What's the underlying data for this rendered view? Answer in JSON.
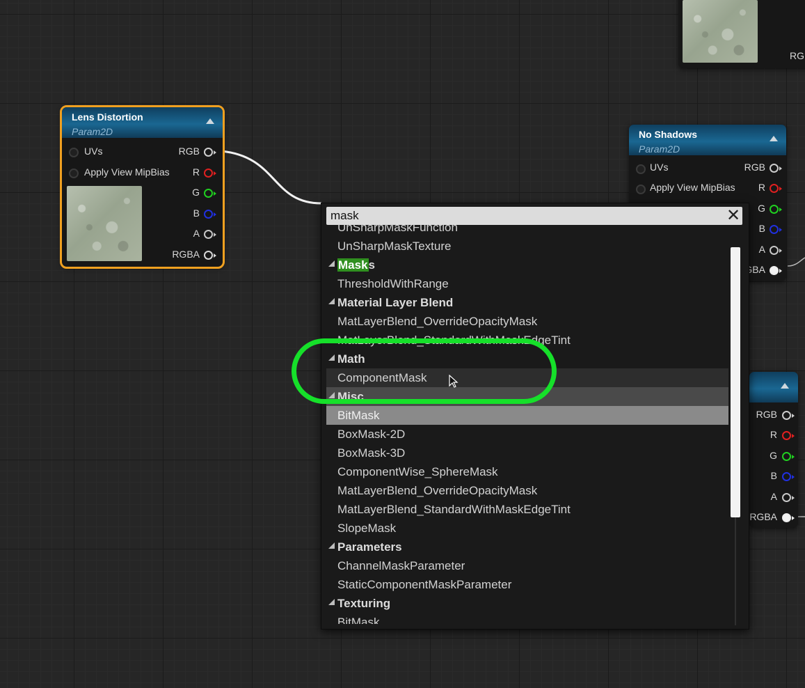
{
  "nodes": {
    "lens": {
      "title": "Lens Distortion",
      "subtitle": "Param2D",
      "inputs": [
        "UVs",
        "Apply View MipBias"
      ],
      "outputs": [
        "RGB",
        "R",
        "G",
        "B",
        "A",
        "RGBA"
      ]
    },
    "noshadows": {
      "title": "No Shadows",
      "subtitle": "Param2D",
      "inputs": [
        "UVs",
        "Apply View MipBias"
      ],
      "outputs": [
        "RGB",
        "R",
        "G",
        "B",
        "A",
        "GBA"
      ]
    },
    "topright": {
      "output_partial": "RGE"
    },
    "right3": {
      "outputs": [
        "RGB",
        "R",
        "G",
        "B",
        "A",
        "RGBA"
      ]
    }
  },
  "colors": {
    "R": "#e02020",
    "G": "#20d020",
    "B": "#2030e0",
    "A": "#c8c8c8",
    "selected_border": "#f0a020",
    "annotation": "#16e02a",
    "match_highlight": "#2f8f1f"
  },
  "search": {
    "value": "mask",
    "clear_icon": "close-icon",
    "items": [
      {
        "text": "UnSharpMaskFunction",
        "kind": "item"
      },
      {
        "text": "UnSharpMaskTexture",
        "kind": "item"
      },
      {
        "text": "Masks",
        "kind": "category",
        "hl": "Mask",
        "rest": "s"
      },
      {
        "text": "ThresholdWithRange",
        "kind": "item"
      },
      {
        "text": "Material Layer Blend",
        "kind": "category"
      },
      {
        "text": "MatLayerBlend_OverrideOpacityMask",
        "kind": "item"
      },
      {
        "text": "MatLayerBlend_StandardWithMaskEdgeTint",
        "kind": "item"
      },
      {
        "text": "Math",
        "kind": "category"
      },
      {
        "text": "ComponentMask",
        "kind": "item",
        "state": "hover"
      },
      {
        "text": "Misc",
        "kind": "category",
        "state": "selbelow"
      },
      {
        "text": "BitMask",
        "kind": "item",
        "state": "sel"
      },
      {
        "text": "BoxMask-2D",
        "kind": "item"
      },
      {
        "text": "BoxMask-3D",
        "kind": "item"
      },
      {
        "text": "ComponentWise_SphereMask",
        "kind": "item"
      },
      {
        "text": "MatLayerBlend_OverrideOpacityMask",
        "kind": "item"
      },
      {
        "text": "MatLayerBlend_StandardWithMaskEdgeTint",
        "kind": "item"
      },
      {
        "text": "SlopeMask",
        "kind": "item"
      },
      {
        "text": "Parameters",
        "kind": "category"
      },
      {
        "text": "ChannelMaskParameter",
        "kind": "item"
      },
      {
        "text": "StaticComponentMaskParameter",
        "kind": "item"
      },
      {
        "text": "Texturing",
        "kind": "category"
      },
      {
        "text": "BitMask",
        "kind": "item"
      }
    ]
  }
}
